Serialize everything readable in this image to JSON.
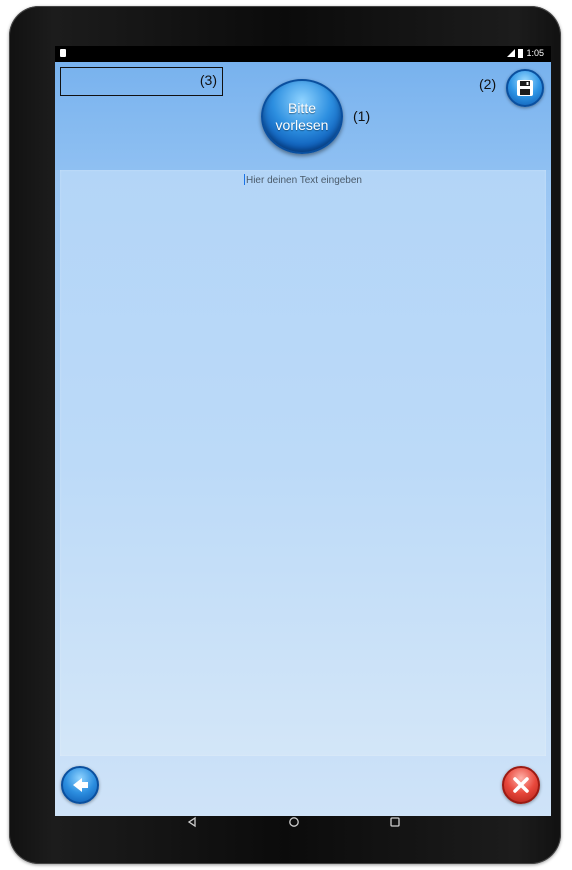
{
  "header": {
    "field_label": "(3)",
    "read_button_line1": "Bitte",
    "read_button_line2": "vorlesen",
    "read_label": "(1)",
    "save_label": "(2)"
  },
  "editor": {
    "placeholder": "Hier deinen Text eingeben"
  },
  "statusbar": {
    "time": "1:05"
  },
  "icons": {
    "save": "floppy-disk-icon",
    "back": "arrow-left-icon",
    "close": "close-x-icon",
    "nav_back": "triangle-back-icon",
    "nav_home": "circle-home-icon",
    "nav_recent": "square-recent-icon"
  },
  "colors": {
    "header_bg": "#78b2ee",
    "editor_bg": "#b3d5f7",
    "accent_blue": "#2d8fe0",
    "close_red": "#e8483c"
  }
}
